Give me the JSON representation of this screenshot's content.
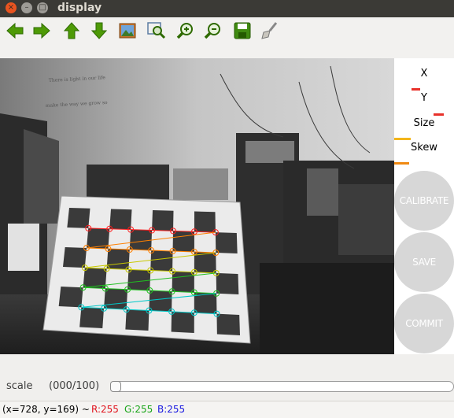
{
  "window": {
    "title": "display"
  },
  "titlebar_buttons": {
    "close": "×",
    "minimize": "–",
    "maximize": "□"
  },
  "toolbar": {
    "icons": [
      "arrow-left-icon",
      "arrow-right-icon",
      "arrow-up-icon",
      "arrow-down-icon",
      "image-icon",
      "zoom-region-icon",
      "zoom-in-icon",
      "zoom-out-icon",
      "save-icon",
      "brush-icon"
    ]
  },
  "panel": {
    "x_label": "X",
    "y_label": "Y",
    "size_label": "Size",
    "skew_label": "Skew",
    "x_progress": 0,
    "y_progress": 0.15,
    "size_progress": 0.17,
    "skew_progress": 0.28,
    "skew2_progress": 0.25,
    "bar_colors": {
      "y": "#e8312a",
      "size": "#e8312a",
      "skew": "#f3b51b",
      "skew2": "#f08a12"
    }
  },
  "buttons": {
    "calibrate": "CALIBRATE",
    "save": "SAVE",
    "commit": "COMMIT"
  },
  "scale": {
    "label": "scale",
    "value": "(000/100)",
    "position": 0
  },
  "status": {
    "coords": "(x=728, y=169) ~",
    "r": "R:255",
    "g": "G:255",
    "b": "B:255",
    "colors": {
      "r": "#e0141e",
      "g": "#1aa51a",
      "b": "#1a1ae0"
    }
  },
  "image": {
    "whiteboard_text_1": "There is light in our life",
    "whiteboard_text_2": "make the way we grow so"
  }
}
